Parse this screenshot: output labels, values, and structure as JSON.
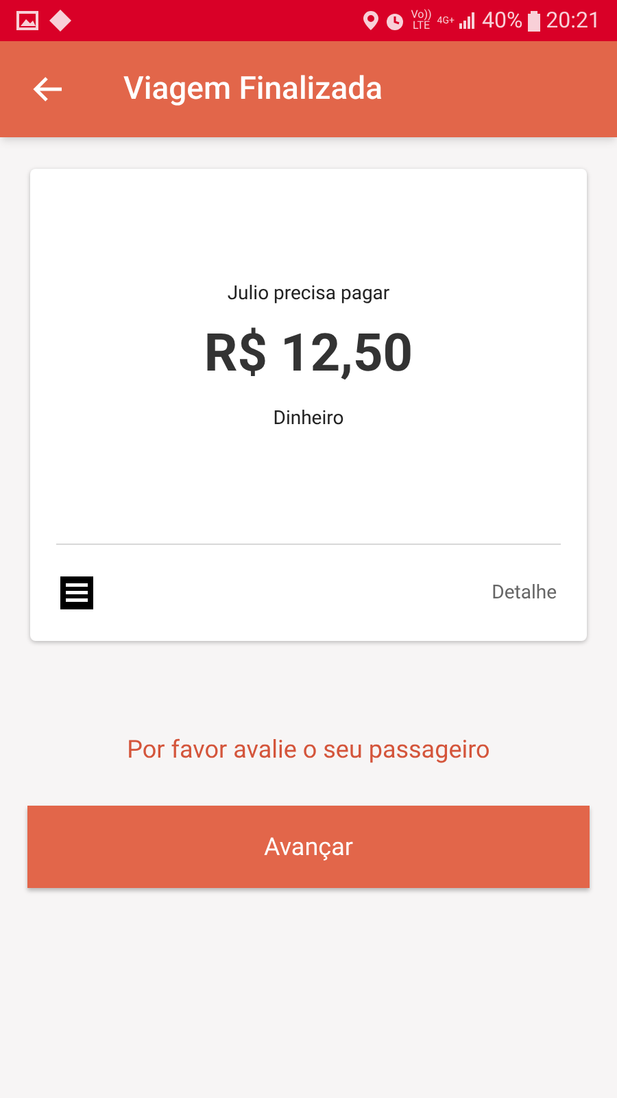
{
  "status_bar": {
    "volte": "Vo))",
    "network": "LTE",
    "network_2": "4G+",
    "battery": "40%",
    "time": "20:21"
  },
  "app_bar": {
    "title": "Viagem Finalizada"
  },
  "card": {
    "caption": "Julio precisa pagar",
    "amount": "R$ 12,50",
    "method": "Dinheiro",
    "detail_link": "Detalhe"
  },
  "prompt": "Por favor avalie o seu passageiro",
  "button": "Avançar"
}
